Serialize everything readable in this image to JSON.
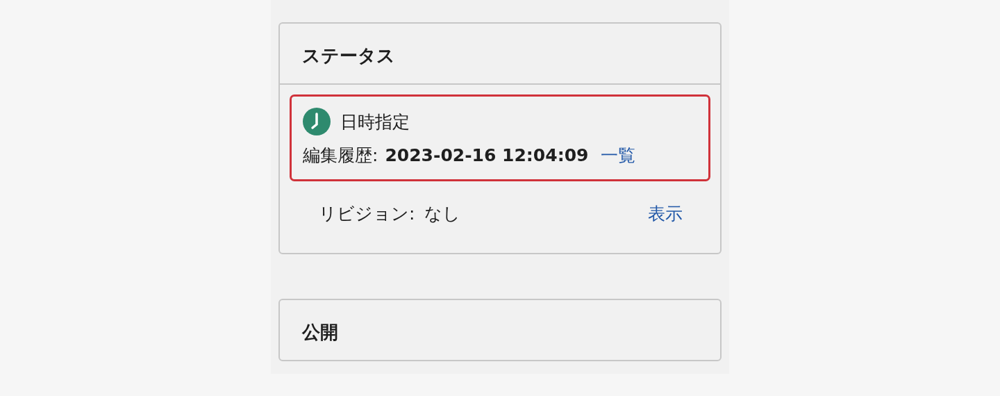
{
  "panels": [
    {
      "title": "ステータス",
      "status": {
        "highlighted": true,
        "label": "日時指定",
        "history_label": "編集履歴:",
        "history_value": "2023-02-16 12:04:09",
        "history_link": "一覧"
      },
      "revision": {
        "label": "リビジョン:",
        "value": "なし",
        "link": "表示"
      }
    },
    {
      "title": "公開"
    }
  ]
}
